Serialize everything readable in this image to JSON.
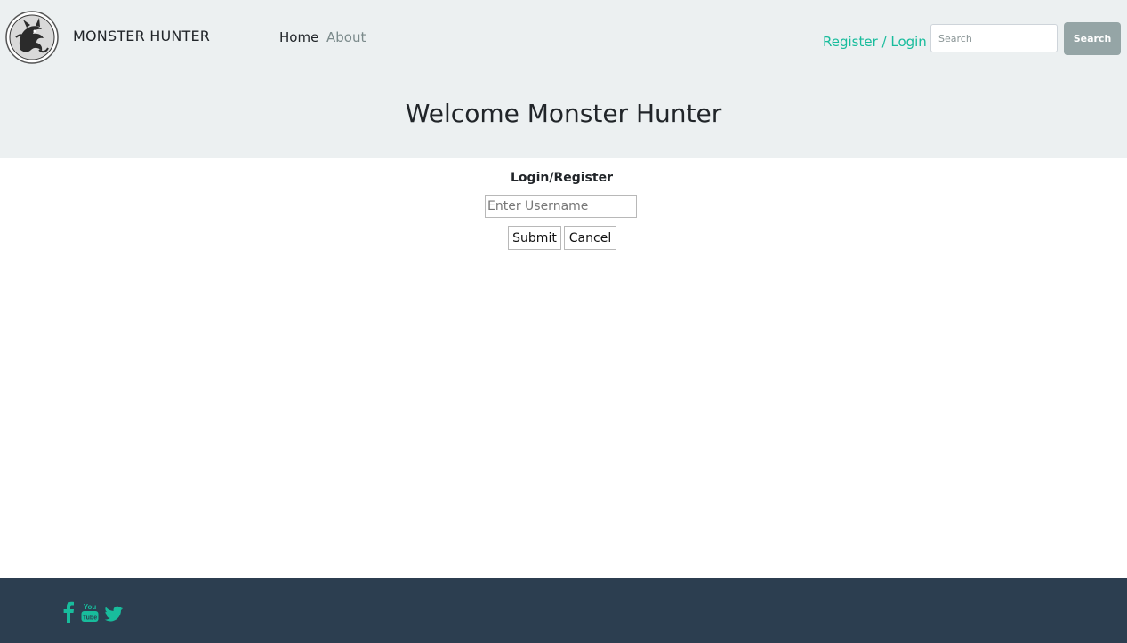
{
  "brand": {
    "name": "MONSTER HUNTER",
    "logo_icon": "dragon-emblem-icon"
  },
  "nav": {
    "home": "Home",
    "about": "About"
  },
  "auth": {
    "register_login": "Register / Login"
  },
  "search": {
    "placeholder": "Search",
    "button_label": "Search"
  },
  "hero": {
    "title": "Welcome Monster Hunter"
  },
  "login_form": {
    "title": "Login/Register",
    "username_placeholder": "Enter Username",
    "submit_label": "Submit",
    "cancel_label": "Cancel"
  },
  "footer": {
    "social_icons": [
      "facebook-icon",
      "youtube-icon",
      "twitter-icon"
    ]
  },
  "colors": {
    "header_bg": "#ecf0f1",
    "accent": "#18bc9c",
    "footer_bg": "#2c3e50",
    "search_button": "#95a5a6"
  }
}
